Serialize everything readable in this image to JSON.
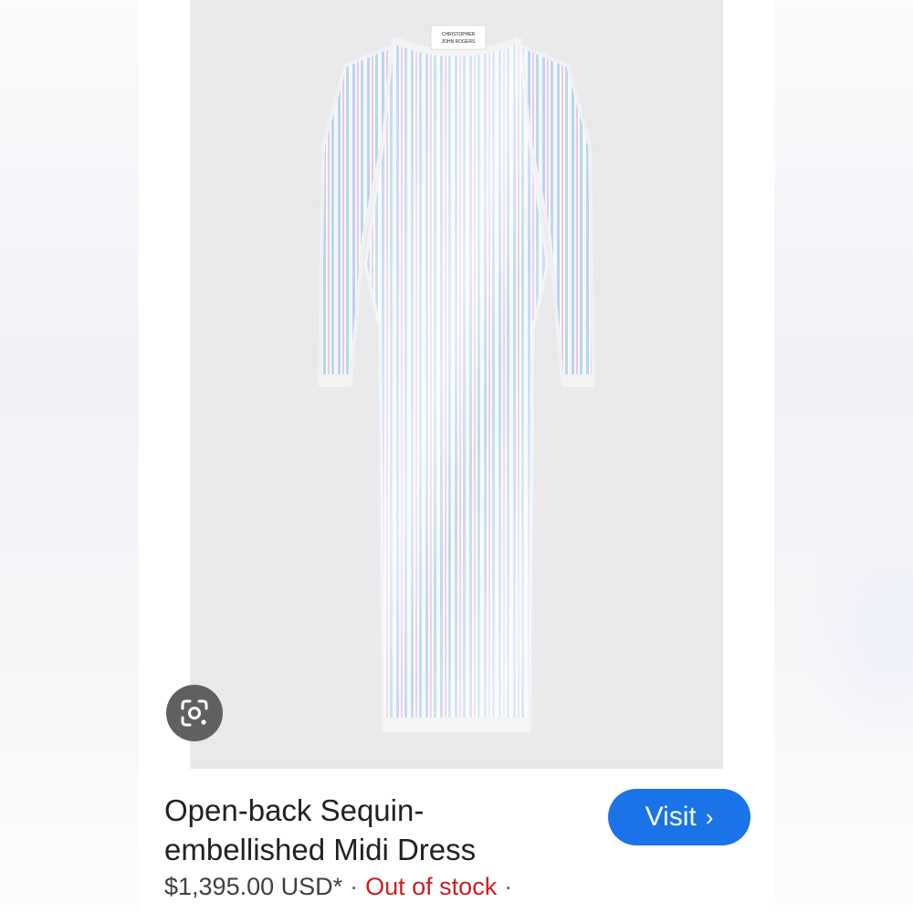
{
  "result": {
    "title_line1": "Open-back Sequin-",
    "title_line2": "embellished Midi Dress",
    "price": "$1,395.00 USD*",
    "separator": "·",
    "stock_status": "Out of stock",
    "trailing_separator": "·",
    "visit_label": "Visit",
    "visit_chevron": "›"
  },
  "product_image": {
    "label_line1": "CHRISTOPHER",
    "label_line2": "JOHN ROGERS",
    "subject": "white sequin striped long-sleeve midi dress"
  },
  "icons": {
    "lens": "google-lens-icon",
    "visit": "chevron-right-icon"
  },
  "colors": {
    "visit_button": "#1a73e8",
    "out_of_stock": "#c5221f",
    "image_background": "#e9e9ec",
    "lens_button": "#5f6062"
  }
}
